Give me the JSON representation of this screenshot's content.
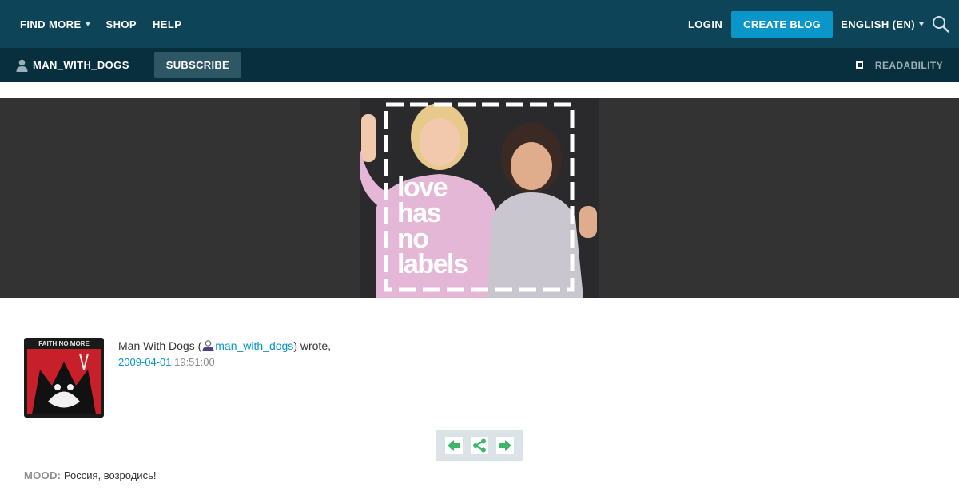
{
  "topnav": {
    "find_more": "FIND MORE",
    "shop": "SHOP",
    "help": "HELP",
    "login": "LOGIN",
    "create_blog": "CREATE BLOG",
    "language": "ENGLISH (EN)"
  },
  "userbar": {
    "username": "MAN_WITH_DOGS",
    "subscribe": "SUBSCRIBE",
    "readability": "READABILITY"
  },
  "banner": {
    "lines": [
      "love",
      "has",
      "no",
      "labels"
    ]
  },
  "userpic": {
    "caption": "FAITH NO MORE"
  },
  "post": {
    "author_name": "Man With Dogs (",
    "author_handle": "man_with_dogs",
    "wrote": ") wrote,",
    "date": "2009-04-01",
    "time": " 19:51:00"
  },
  "mood": {
    "label": "MOOD:",
    "value": " Россия, возродись!"
  },
  "colors": {
    "topbar": "#0d4457",
    "userbar": "#082f3d",
    "accent": "#0a96c8",
    "share_green": "#3db66a"
  }
}
